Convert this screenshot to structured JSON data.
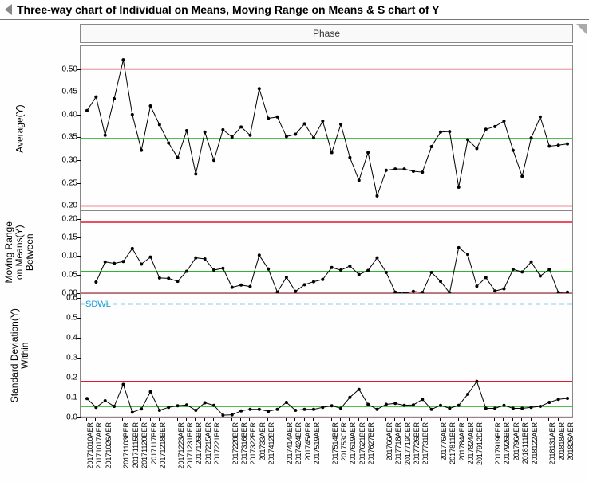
{
  "title": "Three-way chart of Individual on Means, Moving Range on Means & S chart of Y",
  "phase_header": "Phase",
  "ylabels": {
    "p0": "Average(Y)",
    "p1": "Moving Range\non Means(Y)\nBetween",
    "p2": "Standard Deviation(Y)\nWithin"
  },
  "sdwl_label": "SDWL",
  "colors": {
    "ucl": "#e3172e",
    "cl": "#13a813",
    "sdwl": "#1a9fd4",
    "border": "#6d6d6d",
    "pt": "#000"
  },
  "chart_data": [
    {
      "type": "line",
      "title": "Average(Y)",
      "ylabel": "Average(Y)",
      "ylim": [
        0.19,
        0.55
      ],
      "yticks": [
        0.2,
        0.25,
        0.3,
        0.35,
        0.4,
        0.45,
        0.5
      ],
      "ucl": 0.5,
      "lcl": 0.2,
      "cl": 0.3475,
      "values": [
        0.409,
        0.439,
        0.355,
        0.435,
        0.52,
        0.4,
        0.322,
        0.419,
        0.378,
        0.338,
        0.306,
        0.365,
        0.27,
        0.362,
        0.3,
        0.367,
        0.351,
        0.373,
        0.355,
        0.457,
        0.392,
        0.395,
        0.352,
        0.357,
        0.38,
        0.349,
        0.386,
        0.317,
        0.379,
        0.306,
        0.256,
        0.317,
        0.222,
        0.278,
        0.281,
        0.281,
        0.276,
        0.274,
        0.33,
        0.362,
        0.363,
        0.241,
        0.345,
        0.326,
        0.368,
        0.374,
        0.386,
        0.322,
        0.265,
        0.349,
        0.395,
        0.331,
        0.333,
        0.336
      ],
      "categories": [
        "20171010AER",
        "20171017AER",
        "20171026AER",
        "20171103BER",
        "20171115BER",
        "20171120BER",
        "2017117BER",
        "20171218BER",
        "20171223AER",
        "20171231BER",
        "2017126BER",
        "2017215AER",
        "2017221BER",
        "2017228BER",
        "2017316BER",
        "2017322BER",
        "201733AER",
        "2017412BER",
        "2017414AER",
        "2017424BER",
        "201745AER",
        "2017519AER",
        "2017514BER",
        "201753CER",
        "2017619AER",
        "2017621BER",
        "2017627BER",
        "201766AER",
        "2017718AER",
        "2017719CER",
        "2017726BER",
        "2017731BER",
        "201776AER",
        "2017811BER",
        "201784AER",
        "2017824AER",
        "2017912DER",
        "2017919BER",
        "2017926BER",
        "201796AER",
        "2018111BER",
        "2018122AER",
        "2018131AER",
        "201818AER",
        "201826AER"
      ]
    },
    {
      "type": "line",
      "title": "Moving Range on Means(Y) Between",
      "ylabel": "Moving Range on Means(Y)",
      "ylim": [
        0.0,
        0.22
      ],
      "yticks": [
        0.0,
        0.05,
        0.1,
        0.15,
        0.2
      ],
      "ucl": 0.19,
      "lcl": 0.0,
      "cl": 0.058,
      "values": [
        null,
        0.03,
        0.084,
        0.08,
        0.085,
        0.12,
        0.078,
        0.097,
        0.041,
        0.04,
        0.032,
        0.059,
        0.095,
        0.092,
        0.062,
        0.067,
        0.016,
        0.022,
        0.018,
        0.102,
        0.065,
        0.003,
        0.043,
        0.005,
        0.023,
        0.031,
        0.037,
        0.069,
        0.062,
        0.073,
        0.05,
        0.061,
        0.095,
        0.056,
        0.003,
        0.0,
        0.005,
        0.002,
        0.056,
        0.032,
        0.001,
        0.122,
        0.104,
        0.019,
        0.042,
        0.006,
        0.012,
        0.064,
        0.057,
        0.084,
        0.046,
        0.064,
        0.002,
        0.003
      ]
    },
    {
      "type": "line",
      "title": "Standard Deviation(Y) Within",
      "ylabel": "Standard Deviation(Y)",
      "ylim": [
        0.0,
        0.62
      ],
      "yticks": [
        0.0,
        0.1,
        0.2,
        0.3,
        0.4,
        0.5,
        0.6
      ],
      "ucl": 0.18,
      "lcl": 0.0,
      "cl": 0.055,
      "sdwl": 0.57,
      "values": [
        0.094,
        0.05,
        0.083,
        0.055,
        0.165,
        0.025,
        0.042,
        0.128,
        0.035,
        0.05,
        0.058,
        0.062,
        0.035,
        0.073,
        0.06,
        0.01,
        0.012,
        0.032,
        0.04,
        0.04,
        0.03,
        0.04,
        0.075,
        0.035,
        0.04,
        0.04,
        0.05,
        0.058,
        0.045,
        0.1,
        0.14,
        0.065,
        0.04,
        0.065,
        0.07,
        0.06,
        0.062,
        0.09,
        0.04,
        0.06,
        0.045,
        0.06,
        0.115,
        0.18,
        0.045,
        0.045,
        0.06,
        0.045,
        0.045,
        0.05,
        0.055,
        0.075,
        0.09,
        0.095
      ]
    }
  ],
  "categories": [
    "20171010AER",
    "20171017AER",
    "20171026AER",
    "20171103BER",
    "20171115BER",
    "20171120BER",
    "2017117BER",
    "20171218BER",
    "20171223AER",
    "20171231BER",
    "2017126BER",
    "2017215AER",
    "2017221BER",
    "2017228BER",
    "2017316BER",
    "2017322BER",
    "201733AER",
    "2017412BER",
    "2017414AER",
    "2017424BER",
    "201745AER",
    "2017519AER",
    "2017514BER",
    "201753CER",
    "2017619AER",
    "2017621BER",
    "2017627BER",
    "201766AER",
    "2017718AER",
    "2017719CER",
    "2017726BER",
    "2017731BER",
    "201776AER",
    "2017811BER",
    "201784AER",
    "2017824AER",
    "2017912DER",
    "2017919BER",
    "2017926BER",
    "201796AER",
    "2018111BER",
    "2018122AER",
    "2018131AER",
    "201818AER",
    "201826AER"
  ]
}
